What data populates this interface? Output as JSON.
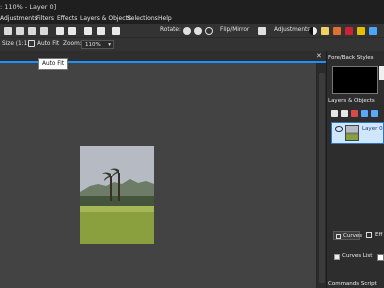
{
  "title_fragment": ": 110% - Layer 0]",
  "menu": [
    "Adjustments",
    "Filters",
    "Effects",
    "Layers & Objects",
    "Selections",
    "Help"
  ],
  "toolbar1": {
    "rotate_label": "Rotate:",
    "flip_label": "Flip/Mirror",
    "adjustments_label": "Adjustments:"
  },
  "toolbar2": {
    "size_label": "Size (1:1)",
    "autofit_label": "Auto Fit",
    "zoom_label": "Zoom:",
    "zoom_value": "110%"
  },
  "tooltip": "Auto Fit",
  "right_panel": {
    "fore_back_title": "Fore/Back Styles",
    "layers_title": "Layers & Objects",
    "layer_name": "Layer 0",
    "tab_curves": "Curves",
    "tab_effects": "Eff",
    "curves_list_label": "Curves List",
    "commands_title": "Commands Script"
  },
  "colors": {
    "accent_blue": "#1e90ff",
    "canvas_bg": "#434343",
    "panel_bg": "#2d2d2d"
  }
}
